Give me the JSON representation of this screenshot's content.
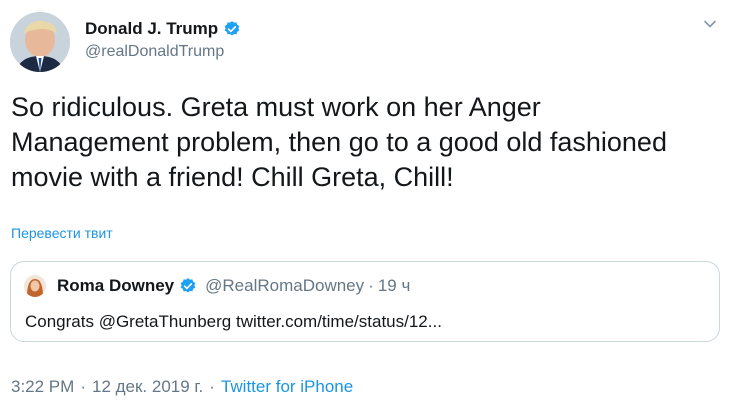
{
  "author": {
    "display_name": "Donald J. Trump",
    "handle": "@realDonaldTrump"
  },
  "tweet": {
    "text": "So ridiculous. Greta must work on her Anger Management problem, then go to a good old fashioned movie with a friend! Chill Greta, Chill!",
    "translate_label": "Перевести твит"
  },
  "quote": {
    "display_name": "Roma Downey",
    "handle": "@RealRomaDowney",
    "separator": "·",
    "time": "19 ч",
    "text": "Congrats @GretaThunberg twitter.com/time/status/12..."
  },
  "footer": {
    "time": "3:22 PM",
    "separator": "·",
    "date": "12 дек. 2019 г.",
    "source": "Twitter for iPhone"
  },
  "icons": {
    "verified": "verified-badge-icon",
    "caret": "chevron-down-icon"
  },
  "colors": {
    "link": "#1b95e0",
    "secondary_text": "#657786",
    "verified": "#1da1f2",
    "border": "#ccd6dd"
  }
}
